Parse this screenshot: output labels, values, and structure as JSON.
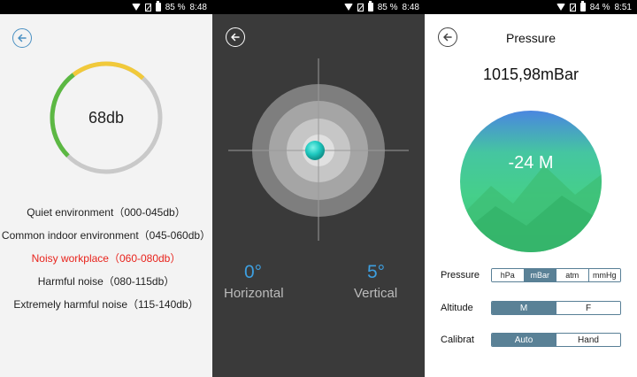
{
  "status_bars": [
    {
      "battery": "85 %",
      "time": "8:48"
    },
    {
      "battery": "85 %",
      "time": "8:48"
    },
    {
      "battery": "84 %",
      "time": "8:51"
    }
  ],
  "sound_meter": {
    "level_text": "68db",
    "level_fraction": 0.4,
    "colors": {
      "arc_green": "#5cb843",
      "arc_yellow": "#f1c93a",
      "track": "#c9c9c9",
      "active_text": "#e8231c"
    },
    "noise_levels": [
      {
        "label": "Quiet environment（000-045db）",
        "active": false
      },
      {
        "label": "Common indoor environment（045-060db）",
        "active": false
      },
      {
        "label": "Noisy workplace（060-080db）",
        "active": true
      },
      {
        "label": "Harmful noise（080-115db）",
        "active": false
      },
      {
        "label": "Extremely harmful noise（115-140db）",
        "active": false
      }
    ]
  },
  "level": {
    "horizontal_value": "0°",
    "horizontal_label": "Horizontal",
    "vertical_value": "5°",
    "vertical_label": "Vertical",
    "colors": {
      "accent": "#3d9fe0",
      "bubble": "#1ec9c0"
    }
  },
  "pressure": {
    "title": "Pressure",
    "reading": "1015,98mBar",
    "altitude_text": "-24 M",
    "settings": [
      {
        "label": "Pressure",
        "options": [
          "hPa",
          "mBar",
          "atm",
          "mmHg"
        ],
        "selected": 1
      },
      {
        "label": "Altitude",
        "options": [
          "M",
          "F"
        ],
        "selected": 0
      },
      {
        "label": "Calibrat",
        "options": [
          "Auto",
          "Hand"
        ],
        "selected": 0
      }
    ],
    "colors": {
      "globe_top": "#4a86e0",
      "globe_mid": "#45cf8a",
      "segment_selected": "#5a8196"
    }
  }
}
